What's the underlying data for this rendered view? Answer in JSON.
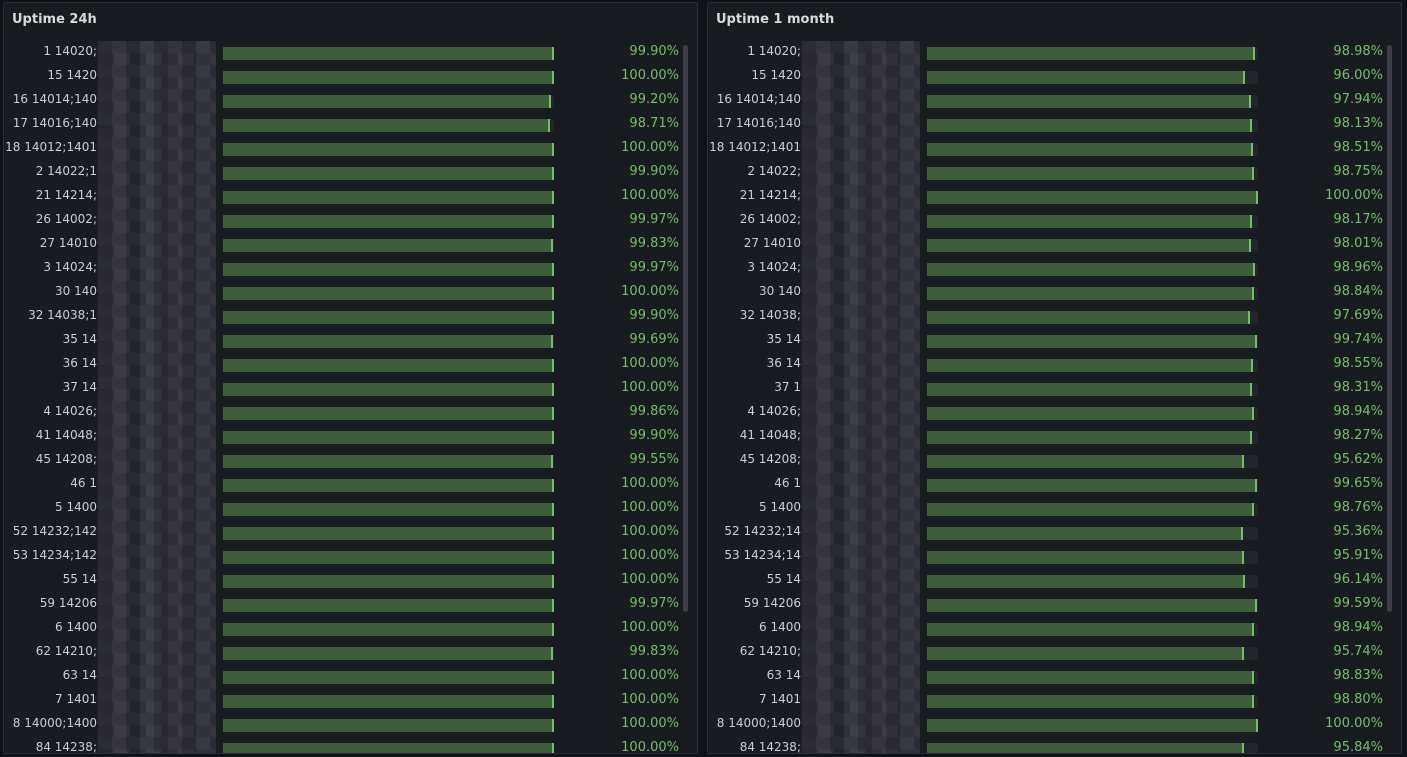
{
  "panels": [
    {
      "title": "Uptime 24h",
      "rows": [
        {
          "label": "1 14020;",
          "value": "99.90%",
          "pct": 99.9
        },
        {
          "label": "15 1420",
          "value": "100.00%",
          "pct": 100.0
        },
        {
          "label": "16 14014;140",
          "value": "99.20%",
          "pct": 99.2
        },
        {
          "label": "17 14016;140",
          "value": "98.71%",
          "pct": 98.71
        },
        {
          "label": "18 14012;1401",
          "value": "100.00%",
          "pct": 100.0
        },
        {
          "label": "2 14022;1",
          "value": "99.90%",
          "pct": 99.9
        },
        {
          "label": "21 14214;",
          "value": "100.00%",
          "pct": 100.0
        },
        {
          "label": "26 14002;",
          "value": "99.97%",
          "pct": 99.97
        },
        {
          "label": "27 14010",
          "value": "99.83%",
          "pct": 99.83
        },
        {
          "label": "3 14024;",
          "value": "99.97%",
          "pct": 99.97
        },
        {
          "label": "30 140",
          "value": "100.00%",
          "pct": 100.0
        },
        {
          "label": "32 14038;1",
          "value": "99.90%",
          "pct": 99.9
        },
        {
          "label": "35 14",
          "value": "99.69%",
          "pct": 99.69
        },
        {
          "label": "36 14",
          "value": "100.00%",
          "pct": 100.0
        },
        {
          "label": "37 14",
          "value": "100.00%",
          "pct": 100.0
        },
        {
          "label": "4 14026;",
          "value": "99.86%",
          "pct": 99.86
        },
        {
          "label": "41 14048;",
          "value": "99.90%",
          "pct": 99.9
        },
        {
          "label": "45 14208;",
          "value": "99.55%",
          "pct": 99.55
        },
        {
          "label": "46 1",
          "value": "100.00%",
          "pct": 100.0
        },
        {
          "label": "5 1400",
          "value": "100.00%",
          "pct": 100.0
        },
        {
          "label": "52 14232;142",
          "value": "100.00%",
          "pct": 100.0
        },
        {
          "label": "53 14234;142",
          "value": "100.00%",
          "pct": 100.0
        },
        {
          "label": "55 14",
          "value": "100.00%",
          "pct": 100.0
        },
        {
          "label": "59 14206",
          "value": "99.97%",
          "pct": 99.97
        },
        {
          "label": "6 1400",
          "value": "100.00%",
          "pct": 100.0
        },
        {
          "label": "62 14210;",
          "value": "99.83%",
          "pct": 99.83
        },
        {
          "label": "63 14",
          "value": "100.00%",
          "pct": 100.0
        },
        {
          "label": "7 1401",
          "value": "100.00%",
          "pct": 100.0
        },
        {
          "label": "8 14000;1400",
          "value": "100.00%",
          "pct": 100.0
        },
        {
          "label": "84 14238;",
          "value": "100.00%",
          "pct": 100.0
        }
      ]
    },
    {
      "title": "Uptime 1 month",
      "rows": [
        {
          "label": "1 14020;",
          "value": "98.98%",
          "pct": 98.98
        },
        {
          "label": "15 1420",
          "value": "96.00%",
          "pct": 96.0
        },
        {
          "label": "16 14014;140",
          "value": "97.94%",
          "pct": 97.94
        },
        {
          "label": "17 14016;140",
          "value": "98.13%",
          "pct": 98.13
        },
        {
          "label": "18 14012;1401",
          "value": "98.51%",
          "pct": 98.51
        },
        {
          "label": "2 14022;",
          "value": "98.75%",
          "pct": 98.75
        },
        {
          "label": "21 14214;",
          "value": "100.00%",
          "pct": 100.0
        },
        {
          "label": "26 14002;",
          "value": "98.17%",
          "pct": 98.17
        },
        {
          "label": "27 14010",
          "value": "98.01%",
          "pct": 98.01
        },
        {
          "label": "3 14024;",
          "value": "98.96%",
          "pct": 98.96
        },
        {
          "label": "30 140",
          "value": "98.84%",
          "pct": 98.84
        },
        {
          "label": "32 14038;",
          "value": "97.69%",
          "pct": 97.69
        },
        {
          "label": "35 14",
          "value": "99.74%",
          "pct": 99.74
        },
        {
          "label": "36 14",
          "value": "98.55%",
          "pct": 98.55
        },
        {
          "label": "37 1",
          "value": "98.31%",
          "pct": 98.31
        },
        {
          "label": "4 14026;",
          "value": "98.94%",
          "pct": 98.94
        },
        {
          "label": "41 14048;",
          "value": "98.27%",
          "pct": 98.27
        },
        {
          "label": "45 14208;",
          "value": "95.62%",
          "pct": 95.62
        },
        {
          "label": "46 1",
          "value": "99.65%",
          "pct": 99.65
        },
        {
          "label": "5 1400",
          "value": "98.76%",
          "pct": 98.76
        },
        {
          "label": "52 14232;14",
          "value": "95.36%",
          "pct": 95.36
        },
        {
          "label": "53 14234;14",
          "value": "95.91%",
          "pct": 95.91
        },
        {
          "label": "55 14",
          "value": "96.14%",
          "pct": 96.14
        },
        {
          "label": "59 14206",
          "value": "99.59%",
          "pct": 99.59
        },
        {
          "label": "6 1400",
          "value": "98.94%",
          "pct": 98.94
        },
        {
          "label": "62 14210;",
          "value": "95.74%",
          "pct": 95.74
        },
        {
          "label": "63 14",
          "value": "98.83%",
          "pct": 98.83
        },
        {
          "label": "7 1401",
          "value": "98.80%",
          "pct": 98.8
        },
        {
          "label": "8 14000;1400",
          "value": "100.00%",
          "pct": 100.0
        },
        {
          "label": "84 14238;",
          "value": "95.84%",
          "pct": 95.84
        }
      ]
    }
  ],
  "colors": {
    "bar_fill": "#3e5e3b",
    "bar_edge": "#73bf69",
    "value_text": "#73bf69",
    "panel_bg": "#181b1f",
    "page_bg": "#111217"
  }
}
